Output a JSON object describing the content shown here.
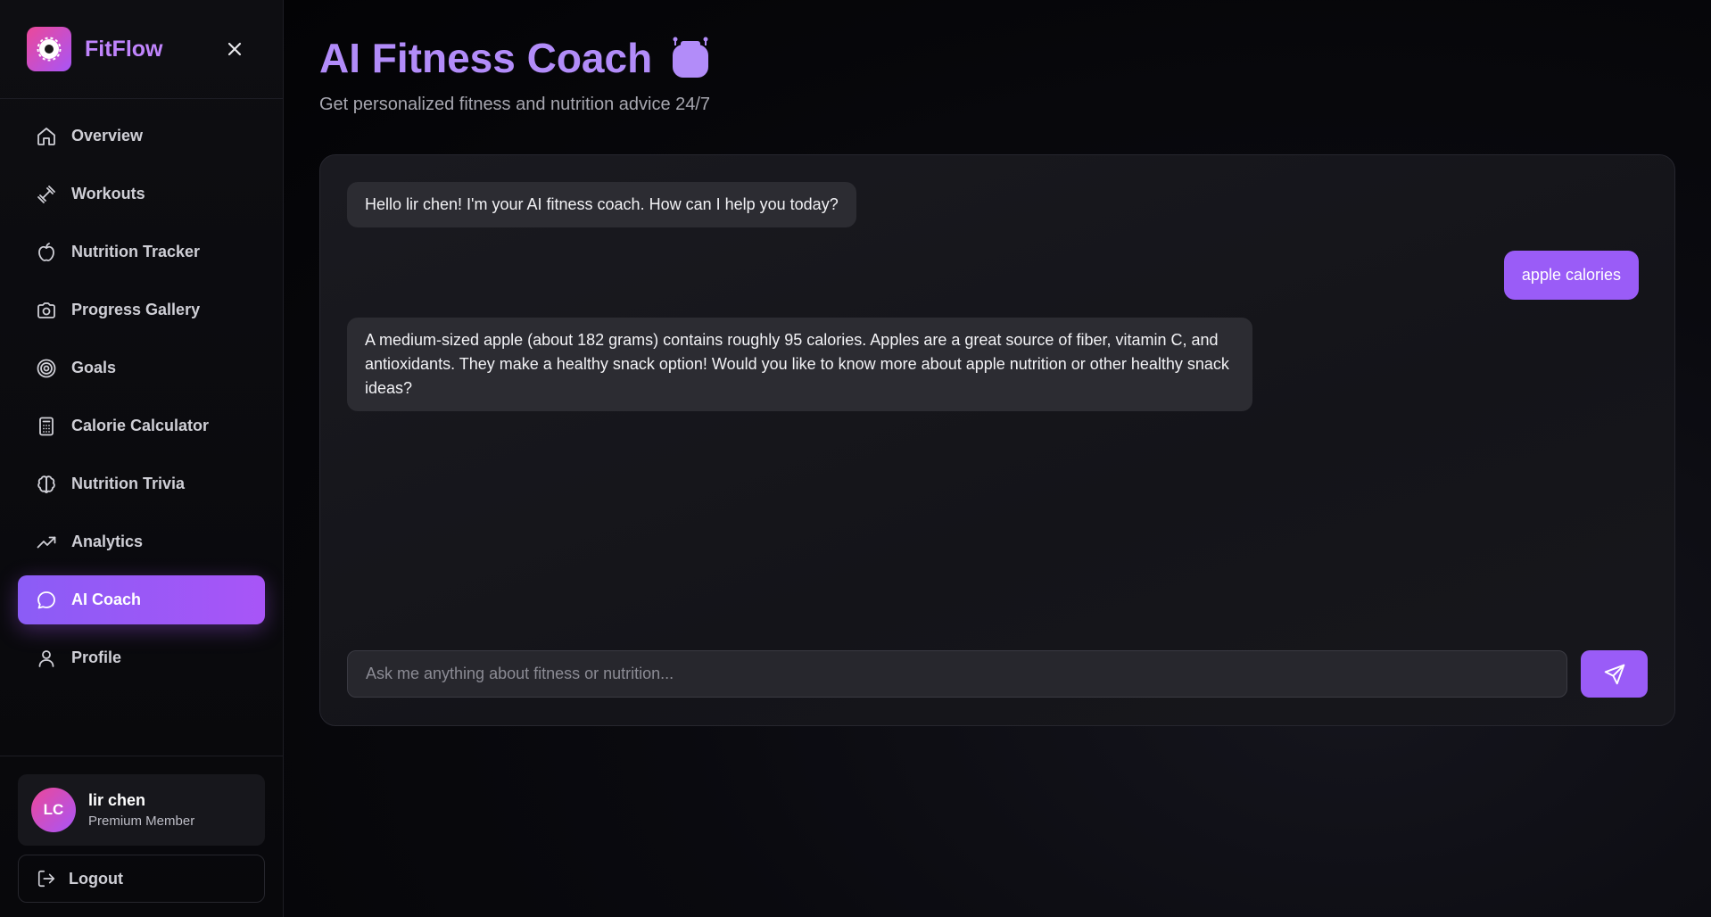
{
  "brand": {
    "name": "FitFlow"
  },
  "sidebar": {
    "items": [
      {
        "label": "Overview",
        "icon": "home-icon"
      },
      {
        "label": "Workouts",
        "icon": "dumbbell-icon"
      },
      {
        "label": "Nutrition Tracker",
        "icon": "apple-icon"
      },
      {
        "label": "Progress Gallery",
        "icon": "camera-icon"
      },
      {
        "label": "Goals",
        "icon": "target-icon"
      },
      {
        "label": "Calorie Calculator",
        "icon": "calculator-icon"
      },
      {
        "label": "Nutrition Trivia",
        "icon": "brain-icon"
      },
      {
        "label": "Analytics",
        "icon": "trending-up-icon"
      },
      {
        "label": "AI Coach",
        "icon": "chat-bubble-icon",
        "active": true
      },
      {
        "label": "Profile",
        "icon": "user-icon"
      }
    ]
  },
  "user": {
    "initials": "LC",
    "name": "lir chen",
    "role": "Premium Member"
  },
  "logout_label": "Logout",
  "header": {
    "title": "AI Fitness Coach",
    "subtitle": "Get personalized fitness and nutrition advice 24/7"
  },
  "chat": {
    "messages": [
      {
        "from": "bot",
        "text": "Hello lir chen! I'm your AI fitness coach. How can I help you today?"
      },
      {
        "from": "user",
        "text": "apple calories"
      },
      {
        "from": "bot",
        "text": "A medium-sized apple (about 182 grams) contains roughly 95 calories. Apples are a great source of fiber, vitamin C, and antioxidants. They make a healthy snack option! Would you like to know more about apple nutrition or other healthy snack ideas?"
      }
    ],
    "input_value": "",
    "input_placeholder": "Ask me anything about fitness or nutrition..."
  },
  "colors": {
    "accent": "#a855f7",
    "accent_pink": "#ec4899",
    "title": "#b28cf9",
    "background": "#050507"
  }
}
